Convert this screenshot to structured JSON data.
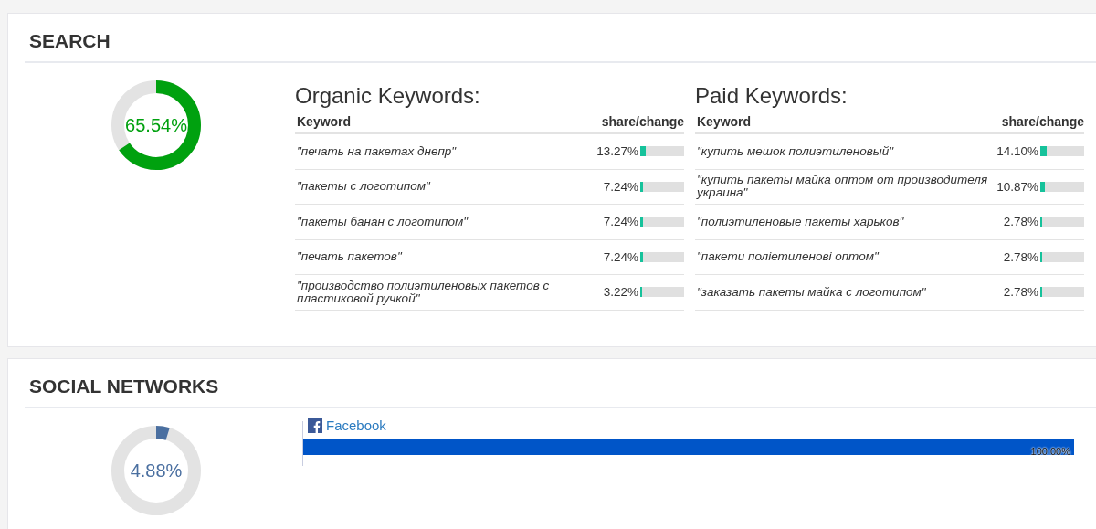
{
  "search": {
    "title": "SEARCH",
    "donut": {
      "label": "65.54%",
      "level": 0.6554
    },
    "organic": {
      "title": "Organic Keywords:",
      "columns": [
        "Keyword",
        "share/change"
      ],
      "rows": [
        {
          "keyword": "\"печать на пакетах днепр\"",
          "share": "13.27%",
          "level": 0.1327
        },
        {
          "keyword": "\"пакеты с логотипом\"",
          "share": "7.24%",
          "level": 0.0724
        },
        {
          "keyword": "\"пакеты банан с логотипом\"",
          "share": "7.24%",
          "level": 0.0724
        },
        {
          "keyword": "\"печать пакетов\"",
          "share": "7.24%",
          "level": 0.0724
        },
        {
          "keyword": "\"производство полиэтиленовых пакетов с пластиковой ручкой\"",
          "share": "3.22%",
          "level": 0.0322
        }
      ]
    },
    "paid": {
      "title": "Paid Keywords:",
      "columns": [
        "Keyword",
        "share/change"
      ],
      "rows": [
        {
          "keyword": "\"купить мешок полиэтиленовый\"",
          "share": "14.10%",
          "level": 0.141
        },
        {
          "keyword": "\"купить пакеты майка оптом от производителя украина\"",
          "share": "10.87%",
          "level": 0.1087
        },
        {
          "keyword": "\"полиэтиленовые пакеты харьков\"",
          "share": "2.78%",
          "level": 0.0278
        },
        {
          "keyword": "\"пакети поліетиленові оптом\"",
          "share": "2.78%",
          "level": 0.0278
        },
        {
          "keyword": "\"заказать пакеты майка с логотипом\"",
          "share": "2.78%",
          "level": 0.0278
        }
      ]
    }
  },
  "social": {
    "title": "SOCIAL NETWORKS",
    "donut": {
      "label": "4.88%",
      "level": 0.0488
    },
    "networks": [
      {
        "name": "Facebook",
        "share": "100.00%",
        "level": 1.0
      }
    ]
  }
}
